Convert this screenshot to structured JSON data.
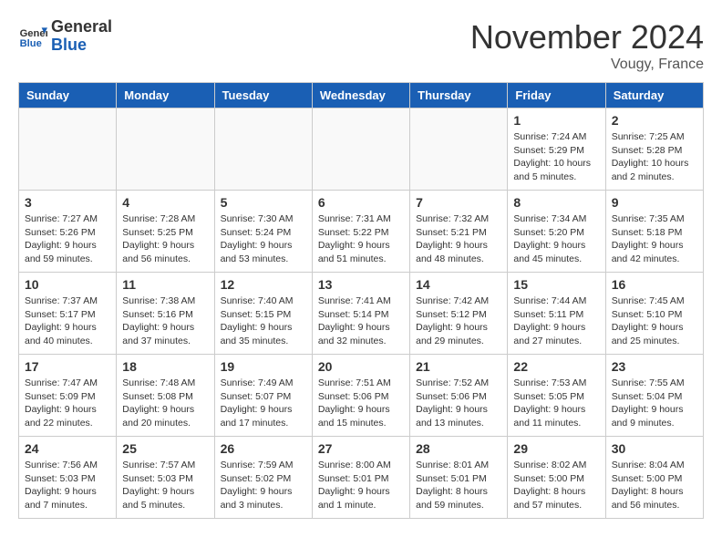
{
  "header": {
    "logo_text_general": "General",
    "logo_text_blue": "Blue",
    "month_title": "November 2024",
    "location": "Vougy, France"
  },
  "weekdays": [
    "Sunday",
    "Monday",
    "Tuesday",
    "Wednesday",
    "Thursday",
    "Friday",
    "Saturday"
  ],
  "weeks": [
    [
      {
        "day": "",
        "info": ""
      },
      {
        "day": "",
        "info": ""
      },
      {
        "day": "",
        "info": ""
      },
      {
        "day": "",
        "info": ""
      },
      {
        "day": "",
        "info": ""
      },
      {
        "day": "1",
        "info": "Sunrise: 7:24 AM\nSunset: 5:29 PM\nDaylight: 10 hours\nand 5 minutes."
      },
      {
        "day": "2",
        "info": "Sunrise: 7:25 AM\nSunset: 5:28 PM\nDaylight: 10 hours\nand 2 minutes."
      }
    ],
    [
      {
        "day": "3",
        "info": "Sunrise: 7:27 AM\nSunset: 5:26 PM\nDaylight: 9 hours\nand 59 minutes."
      },
      {
        "day": "4",
        "info": "Sunrise: 7:28 AM\nSunset: 5:25 PM\nDaylight: 9 hours\nand 56 minutes."
      },
      {
        "day": "5",
        "info": "Sunrise: 7:30 AM\nSunset: 5:24 PM\nDaylight: 9 hours\nand 53 minutes."
      },
      {
        "day": "6",
        "info": "Sunrise: 7:31 AM\nSunset: 5:22 PM\nDaylight: 9 hours\nand 51 minutes."
      },
      {
        "day": "7",
        "info": "Sunrise: 7:32 AM\nSunset: 5:21 PM\nDaylight: 9 hours\nand 48 minutes."
      },
      {
        "day": "8",
        "info": "Sunrise: 7:34 AM\nSunset: 5:20 PM\nDaylight: 9 hours\nand 45 minutes."
      },
      {
        "day": "9",
        "info": "Sunrise: 7:35 AM\nSunset: 5:18 PM\nDaylight: 9 hours\nand 42 minutes."
      }
    ],
    [
      {
        "day": "10",
        "info": "Sunrise: 7:37 AM\nSunset: 5:17 PM\nDaylight: 9 hours\nand 40 minutes."
      },
      {
        "day": "11",
        "info": "Sunrise: 7:38 AM\nSunset: 5:16 PM\nDaylight: 9 hours\nand 37 minutes."
      },
      {
        "day": "12",
        "info": "Sunrise: 7:40 AM\nSunset: 5:15 PM\nDaylight: 9 hours\nand 35 minutes."
      },
      {
        "day": "13",
        "info": "Sunrise: 7:41 AM\nSunset: 5:14 PM\nDaylight: 9 hours\nand 32 minutes."
      },
      {
        "day": "14",
        "info": "Sunrise: 7:42 AM\nSunset: 5:12 PM\nDaylight: 9 hours\nand 29 minutes."
      },
      {
        "day": "15",
        "info": "Sunrise: 7:44 AM\nSunset: 5:11 PM\nDaylight: 9 hours\nand 27 minutes."
      },
      {
        "day": "16",
        "info": "Sunrise: 7:45 AM\nSunset: 5:10 PM\nDaylight: 9 hours\nand 25 minutes."
      }
    ],
    [
      {
        "day": "17",
        "info": "Sunrise: 7:47 AM\nSunset: 5:09 PM\nDaylight: 9 hours\nand 22 minutes."
      },
      {
        "day": "18",
        "info": "Sunrise: 7:48 AM\nSunset: 5:08 PM\nDaylight: 9 hours\nand 20 minutes."
      },
      {
        "day": "19",
        "info": "Sunrise: 7:49 AM\nSunset: 5:07 PM\nDaylight: 9 hours\nand 17 minutes."
      },
      {
        "day": "20",
        "info": "Sunrise: 7:51 AM\nSunset: 5:06 PM\nDaylight: 9 hours\nand 15 minutes."
      },
      {
        "day": "21",
        "info": "Sunrise: 7:52 AM\nSunset: 5:06 PM\nDaylight: 9 hours\nand 13 minutes."
      },
      {
        "day": "22",
        "info": "Sunrise: 7:53 AM\nSunset: 5:05 PM\nDaylight: 9 hours\nand 11 minutes."
      },
      {
        "day": "23",
        "info": "Sunrise: 7:55 AM\nSunset: 5:04 PM\nDaylight: 9 hours\nand 9 minutes."
      }
    ],
    [
      {
        "day": "24",
        "info": "Sunrise: 7:56 AM\nSunset: 5:03 PM\nDaylight: 9 hours\nand 7 minutes."
      },
      {
        "day": "25",
        "info": "Sunrise: 7:57 AM\nSunset: 5:03 PM\nDaylight: 9 hours\nand 5 minutes."
      },
      {
        "day": "26",
        "info": "Sunrise: 7:59 AM\nSunset: 5:02 PM\nDaylight: 9 hours\nand 3 minutes."
      },
      {
        "day": "27",
        "info": "Sunrise: 8:00 AM\nSunset: 5:01 PM\nDaylight: 9 hours\nand 1 minute."
      },
      {
        "day": "28",
        "info": "Sunrise: 8:01 AM\nSunset: 5:01 PM\nDaylight: 8 hours\nand 59 minutes."
      },
      {
        "day": "29",
        "info": "Sunrise: 8:02 AM\nSunset: 5:00 PM\nDaylight: 8 hours\nand 57 minutes."
      },
      {
        "day": "30",
        "info": "Sunrise: 8:04 AM\nSunset: 5:00 PM\nDaylight: 8 hours\nand 56 minutes."
      }
    ]
  ]
}
